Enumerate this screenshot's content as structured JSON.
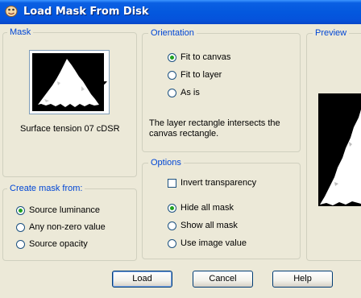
{
  "window": {
    "title": "Load Mask From Disk",
    "icon": "paint-shop-pro-icon"
  },
  "mask_group": {
    "label": "Mask",
    "thumbnail_icon": "white-triangle-mask-thumbnail",
    "selected_mask_name": "Surface tension 07 cDSR"
  },
  "orientation": {
    "label": "Orientation",
    "options": [
      {
        "label": "Fit to canvas",
        "selected": true
      },
      {
        "label": "Fit to layer",
        "selected": false
      },
      {
        "label": "As is",
        "selected": false
      }
    ],
    "description": "The layer rectangle intersects the canvas rectangle."
  },
  "preview": {
    "label": "Preview"
  },
  "create_mask_from": {
    "label": "Create mask from:",
    "options": [
      {
        "label": "Source luminance",
        "selected": true
      },
      {
        "label": "Any non-zero value",
        "selected": false
      },
      {
        "label": "Source opacity",
        "selected": false
      }
    ]
  },
  "options": {
    "label": "Options",
    "invert_transparency": {
      "label": "Invert transparency",
      "checked": false
    },
    "radios": [
      {
        "label": "Hide all mask",
        "selected": true
      },
      {
        "label": "Show all mask",
        "selected": false
      },
      {
        "label": "Use image value",
        "selected": false
      }
    ]
  },
  "buttons": {
    "load": "Load",
    "cancel": "Cancel",
    "help": "Help"
  },
  "colors": {
    "title_bar": "#0458de",
    "dialog_bg": "#ece9d8",
    "group_label": "#0046d5",
    "radio_dot": "#21a121"
  }
}
